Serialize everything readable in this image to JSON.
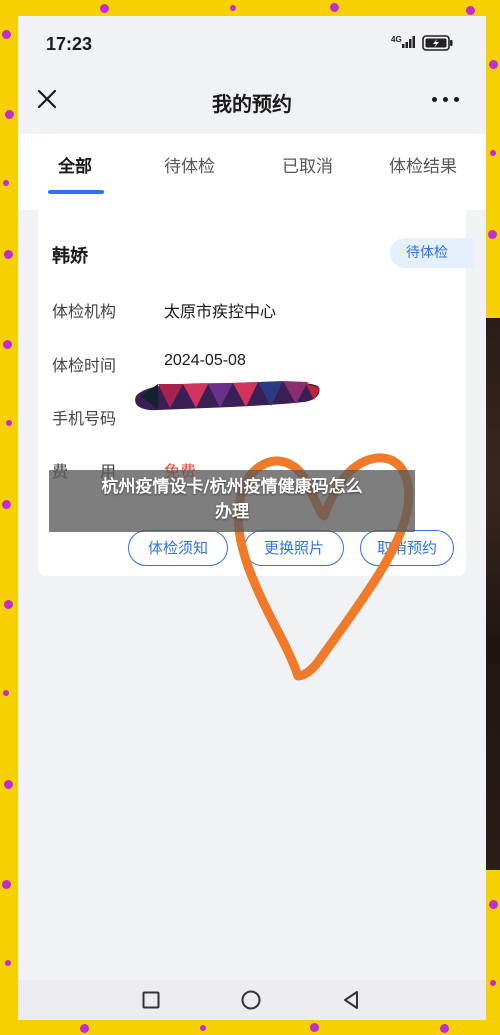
{
  "status_bar": {
    "time": "17:23",
    "network": "4G",
    "signal_icon": "signal-icon",
    "battery_icon": "battery-charging-icon"
  },
  "nav": {
    "title": "我的预约",
    "close_icon": "close-icon",
    "more_icon": "more-icon"
  },
  "tabs": [
    {
      "label": "全部",
      "active": true
    },
    {
      "label": "待体检",
      "active": false
    },
    {
      "label": "已取消",
      "active": false
    },
    {
      "label": "体检结果",
      "active": false
    }
  ],
  "accent_color": "#2f73e6",
  "card": {
    "name": "韩娇",
    "status": "待体检",
    "rows": [
      {
        "label": "体检机构",
        "value": "太原市疾控中心"
      },
      {
        "label": "体检时间",
        "value": "2024-05-08"
      },
      {
        "label": "手机号码",
        "value": ""
      },
      {
        "label": "费　　用",
        "value": "免费"
      }
    ],
    "fee_color": "#e0473a",
    "buttons": [
      {
        "label": "体检须知"
      },
      {
        "label": "更换照片"
      },
      {
        "label": "取消预约"
      }
    ]
  },
  "overlay": {
    "line1": "杭州疫情设卡/杭州疫情健康码怎么",
    "line2": "办理"
  },
  "system_nav": {
    "recents_icon": "square-icon",
    "home_icon": "circle-icon",
    "back_icon": "triangle-back-icon"
  }
}
